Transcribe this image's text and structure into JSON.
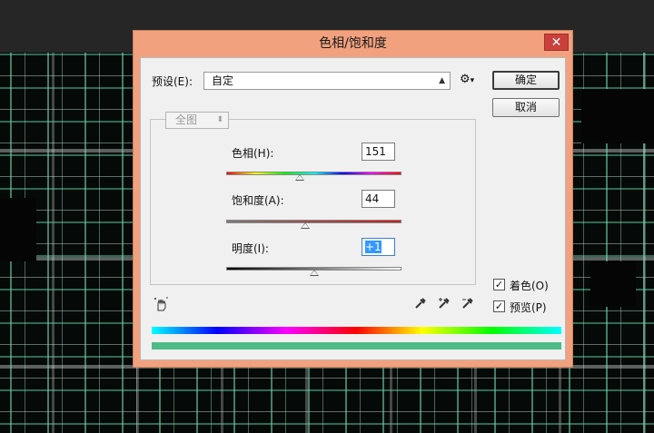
{
  "dialog": {
    "title": "色相/饱和度",
    "close_label": "✕"
  },
  "preset": {
    "label": "预设(E):",
    "value": "自定",
    "gear_icon": "⚙",
    "gear_arrow": "▾"
  },
  "buttons": {
    "ok": "确定",
    "cancel": "取消"
  },
  "channel": {
    "value": "全图"
  },
  "hue": {
    "label": "色相(H):",
    "value": "151",
    "position": 0.42
  },
  "saturation": {
    "label": "饱和度(A):",
    "value": "44",
    "position": 0.45
  },
  "lightness": {
    "label": "明度(I):",
    "value": "+1",
    "position": 0.505
  },
  "options": {
    "colorize_label": "着色(O)",
    "colorize_checked": true,
    "preview_label": "预览(P)",
    "preview_checked": true
  },
  "icons": {
    "hand": "hand-adjust-icon",
    "eyedroppers": [
      "eyedropper-icon",
      "eyedropper-add-icon",
      "eyedropper-subtract-icon"
    ]
  },
  "colors": {
    "dialog_frame": "#f1a17e",
    "close_button": "#c9413a",
    "result_bar": "#4fbb88",
    "hue_tint": "#3399ff"
  }
}
